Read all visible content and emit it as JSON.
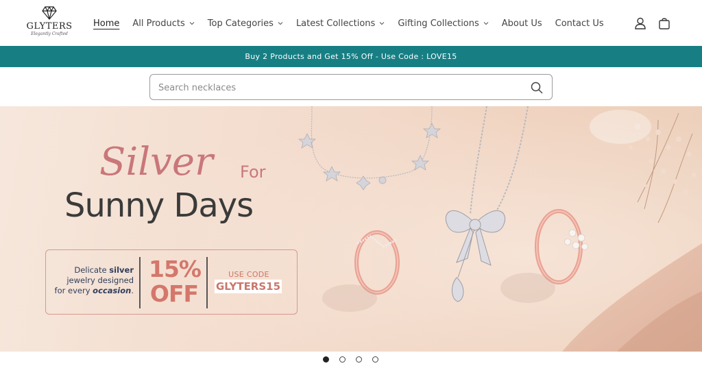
{
  "brand": {
    "name": "GLYTERS",
    "tagline": "Elegantly Crafted"
  },
  "nav": {
    "items": [
      {
        "label": "Home",
        "active": true,
        "dropdown": false
      },
      {
        "label": "All Products",
        "active": false,
        "dropdown": true
      },
      {
        "label": "Top Categories",
        "active": false,
        "dropdown": true
      },
      {
        "label": "Latest Collections",
        "active": false,
        "dropdown": true
      },
      {
        "label": "Gifting Collections",
        "active": false,
        "dropdown": true
      },
      {
        "label": "About Us",
        "active": false,
        "dropdown": false
      },
      {
        "label": "Contact Us",
        "active": false,
        "dropdown": false
      }
    ],
    "icons": [
      "account-icon",
      "cart-icon"
    ]
  },
  "announcement": {
    "text": "Buy 2 Products and Get 15% Off - Use Code : LOVE15"
  },
  "search": {
    "placeholder": "Search necklaces",
    "value": ""
  },
  "banner": {
    "headline_script": "Silver",
    "headline_for": "For",
    "headline_main": "Sunny Days",
    "promo_line1_pre": "Delicate ",
    "promo_line1_bold": "silver",
    "promo_line2": "jewelry designed",
    "promo_line3_pre": "for every ",
    "promo_line3_bold": "occasion",
    "promo_line3_post": ".",
    "discount_pct": "15%",
    "discount_off": "OFF",
    "use_code_label": "USE CODE",
    "code": "GLYTERS15"
  },
  "slider": {
    "count": 4,
    "active_index": 0
  },
  "colors": {
    "announcement_bg": "#177f84",
    "accent_rose": "#c9777a",
    "text_dark": "#3a3a3a"
  }
}
